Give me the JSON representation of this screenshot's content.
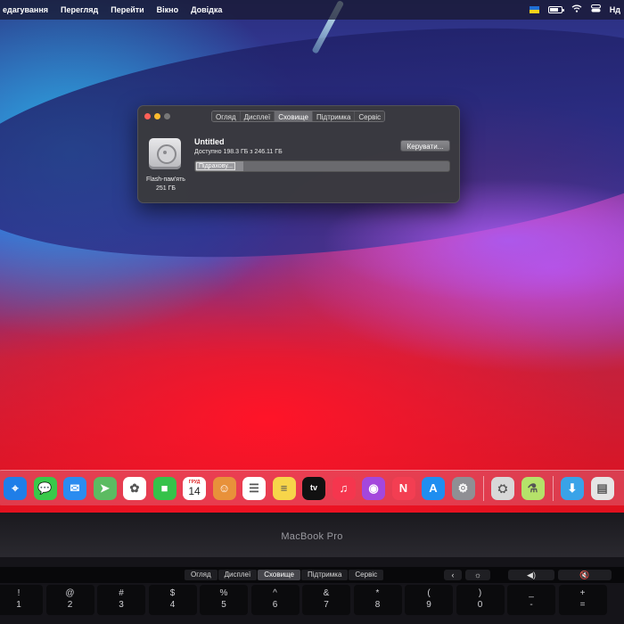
{
  "menubar": {
    "items": [
      "едагування",
      "Перегляд",
      "Перейти",
      "Вікно",
      "Довідка"
    ],
    "language": "Нд",
    "flag_colors": [
      "#1f6fd6",
      "#f6d21a"
    ],
    "icons": [
      "flag-icon",
      "battery-icon",
      "wifi-icon",
      "control-center-icon",
      "language-icon"
    ]
  },
  "window": {
    "tabs": [
      "Огляд",
      "Дисплеї",
      "Сховище",
      "Підтримка",
      "Сервіс"
    ],
    "active_tab": "Сховище",
    "disk": {
      "name": "Flash-пам'ять",
      "size": "251 ГБ"
    },
    "volume": {
      "name": "Untitled",
      "available": "Доступно 198.3 ГБ з 246.11 ГБ",
      "status": "Підрахову...",
      "used_fraction": 0.19
    },
    "manage_label": "Керувати..."
  },
  "dock": {
    "apps": [
      {
        "name": "safari-icon",
        "color": "#1f7ee8",
        "glyph": "⌖"
      },
      {
        "name": "messages-icon",
        "color": "#38c94a",
        "glyph": "💬"
      },
      {
        "name": "mail-icon",
        "color": "#2b8cf0",
        "glyph": "✉"
      },
      {
        "name": "maps-icon",
        "color": "#5cbb62",
        "glyph": "➤"
      },
      {
        "name": "photos-icon",
        "color": "#ffffff",
        "glyph": "✿"
      },
      {
        "name": "facetime-icon",
        "color": "#35c24a",
        "glyph": "■"
      },
      {
        "name": "calendar-icon",
        "color": "#ffffff",
        "month": "ГРУД",
        "day": "14"
      },
      {
        "name": "contacts-icon",
        "color": "#e8913a",
        "glyph": "☺"
      },
      {
        "name": "reminders-icon",
        "color": "#ffffff",
        "glyph": "☰"
      },
      {
        "name": "notes-icon",
        "color": "#f7d54a",
        "glyph": "≡"
      },
      {
        "name": "apple-tv-icon",
        "color": "#111111",
        "glyph": "tv"
      },
      {
        "name": "music-icon",
        "color": "#f5364e",
        "glyph": "♫"
      },
      {
        "name": "podcasts-icon",
        "color": "#a447dc",
        "glyph": "◉"
      },
      {
        "name": "news-icon",
        "color": "#f33e52",
        "glyph": "N"
      },
      {
        "name": "app-store-icon",
        "color": "#1f8ef0",
        "glyph": "A"
      },
      {
        "name": "system-preferences-icon",
        "color": "#8f8f94",
        "glyph": "⚙"
      }
    ],
    "extra": [
      {
        "name": "disk-utility-icon",
        "color": "#d8d8d8",
        "glyph": "⛭"
      },
      {
        "name": "potion-app-icon",
        "color": "#b5e26a",
        "glyph": "⚗"
      }
    ],
    "trailing": [
      {
        "name": "downloads-folder-icon",
        "color": "#39a3e8",
        "glyph": "⬇"
      },
      {
        "name": "stack-icon",
        "color": "#e5e5e5",
        "glyph": "▤"
      }
    ]
  },
  "laptop": {
    "brand": "MacBook Pro"
  },
  "touchbar": {
    "tabs": [
      "Огляд",
      "Дисплеї",
      "Сховище",
      "Підтримка",
      "Сервіс"
    ],
    "active_tab": "Сховище",
    "controls": [
      "‹",
      "☼",
      "◀︎)",
      "🔇"
    ]
  },
  "keyboard": {
    "keys": [
      [
        "!",
        "1"
      ],
      [
        "@",
        "2"
      ],
      [
        "#",
        "3"
      ],
      [
        "$",
        "4"
      ],
      [
        "%",
        "5"
      ],
      [
        "^",
        "6"
      ],
      [
        "&",
        "7"
      ],
      [
        "*",
        "8"
      ],
      [
        "(",
        "9"
      ],
      [
        ")",
        "0"
      ],
      [
        "_",
        "-"
      ],
      [
        "+",
        "="
      ]
    ]
  }
}
